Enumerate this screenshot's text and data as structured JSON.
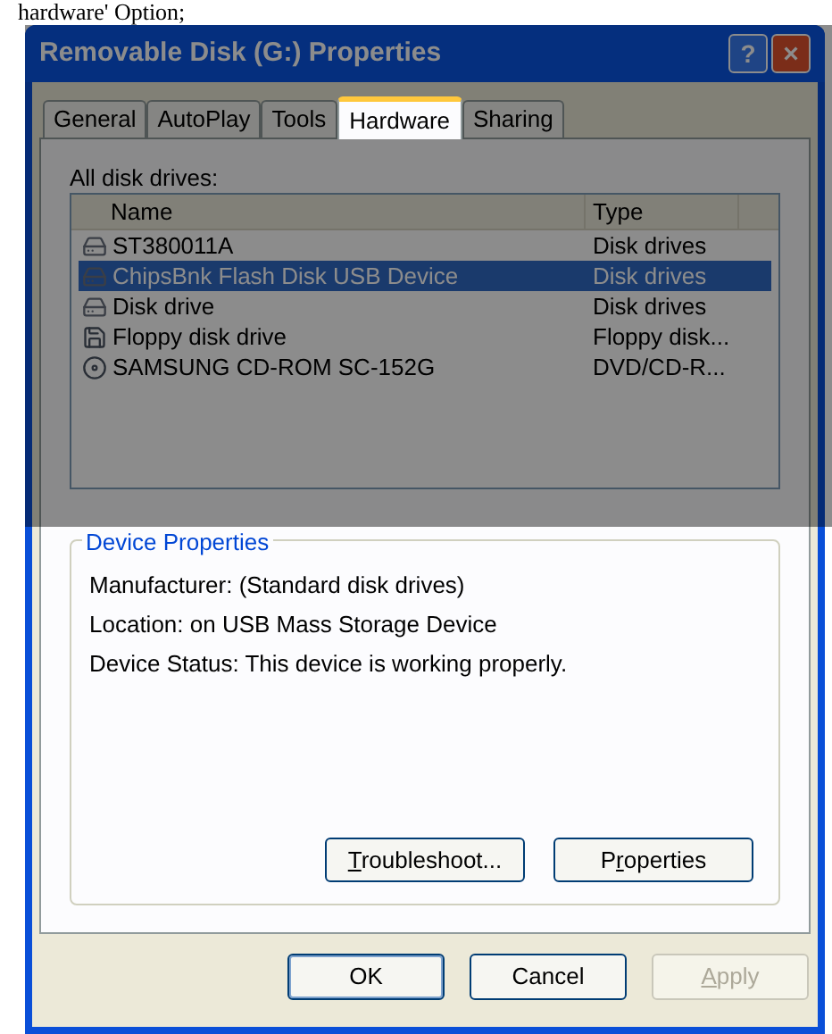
{
  "caption": "hardware' Option;",
  "window": {
    "title": "Removable Disk (G:) Properties",
    "help": "?",
    "close": "×"
  },
  "tabs": [
    {
      "label": "General",
      "selected": false
    },
    {
      "label": "AutoPlay",
      "selected": false
    },
    {
      "label": "Tools",
      "selected": false
    },
    {
      "label": "Hardware",
      "selected": true
    },
    {
      "label": "Sharing",
      "selected": false
    }
  ],
  "drives_label": "All disk drives:",
  "table": {
    "columns": [
      "Name",
      "Type"
    ],
    "rows": [
      {
        "kind": "disk",
        "name": "ST380011A",
        "type": "Disk drives",
        "selected": false
      },
      {
        "kind": "disk",
        "name": "ChipsBnk Flash Disk USB Device",
        "type": "Disk drives",
        "selected": true
      },
      {
        "kind": "disk",
        "name": "Disk drive",
        "type": "Disk drives",
        "selected": false
      },
      {
        "kind": "floppy",
        "name": "Floppy disk drive",
        "type": "Floppy disk...",
        "selected": false
      },
      {
        "kind": "cdrom",
        "name": "SAMSUNG CD-ROM SC-152G",
        "type": "DVD/CD-R...",
        "selected": false
      }
    ]
  },
  "device_properties": {
    "title": "Device Properties",
    "lines": [
      "Manufacturer: (Standard disk drives)",
      "Location: on USB Mass Storage Device",
      "Device Status: This device is working properly."
    ],
    "buttons": [
      {
        "hotkey": "T",
        "label_after": "roubleshoot..."
      },
      {
        "label_before": "P",
        "hotkey": "r",
        "label_after": "operties"
      }
    ]
  },
  "dialog_buttons": [
    {
      "label": "OK",
      "disabled": false,
      "default": true
    },
    {
      "label": "Cancel",
      "disabled": false,
      "default": false
    },
    {
      "hotkey": "A",
      "label_after": "pply",
      "disabled": true,
      "default": false
    }
  ]
}
